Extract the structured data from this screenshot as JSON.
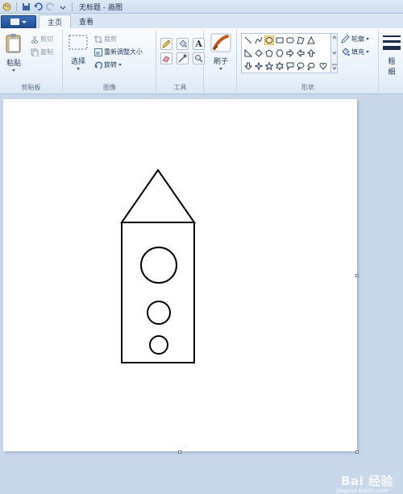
{
  "window": {
    "title": "无标题 - 画图"
  },
  "tabs": [
    {
      "label": "主页",
      "active": true
    },
    {
      "label": "查看",
      "active": false
    }
  ],
  "ribbon": {
    "clipboard": {
      "label": "剪贴板",
      "paste": "粘贴",
      "cut": "剪切",
      "copy": "复制"
    },
    "image": {
      "label": "图像",
      "select": "选择",
      "crop": "裁剪",
      "resize": "重新调整大小",
      "rotate": "旋转"
    },
    "tools": {
      "label": "工具",
      "text_tool_glyph": "A"
    },
    "brushes": {
      "label": "刷子"
    },
    "shapes": {
      "label": "形状",
      "outline": "轮廓",
      "fill": "填充"
    },
    "size": {
      "label_line1": "粗",
      "label_line2": "细"
    }
  },
  "watermark": {
    "text": "Bai 经验",
    "sub": "jingyan.baidu.com"
  },
  "colors": {
    "ribbon_bg": "#eaf1fa",
    "workspace_bg": "#c9d7ea",
    "file_button": "#2a5aa5",
    "selected_shape": "#fde8a4",
    "drawing_stroke": "#000000"
  }
}
